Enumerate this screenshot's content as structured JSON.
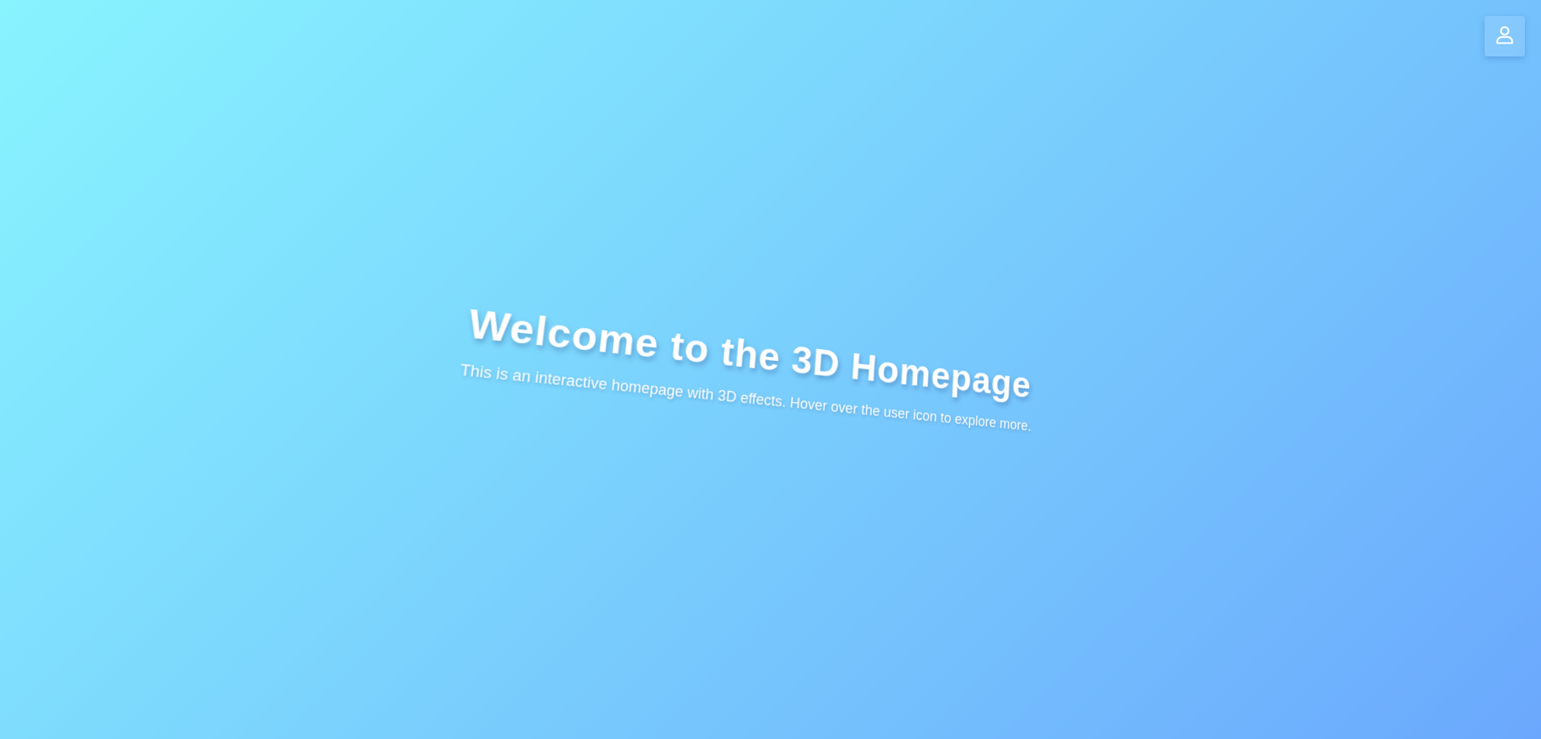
{
  "header": {
    "user_button_icon": "user-icon"
  },
  "hero": {
    "title": "Welcome to the 3D Homepage",
    "subtitle": "This is an interactive homepage with 3D effects. Hover over the user icon to explore more."
  },
  "colors": {
    "gradient_start": "#88f4fe",
    "gradient_mid": "#7bd3fd",
    "gradient_end": "#6ba8fd",
    "text": "#ffffff"
  }
}
